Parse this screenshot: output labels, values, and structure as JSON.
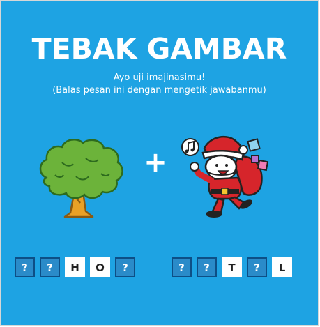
{
  "title": "TEBAK GAMBAR",
  "subtitle_line1": "Ayo uji imajinasimu!",
  "subtitle_line2": "(Balas pesan ini dengan mengetik jawabanmu)",
  "operator": "+",
  "clue_left_icon": "tree-icon",
  "clue_right_icon": "santa-claus-icon",
  "colors": {
    "background": "#1ea3e3",
    "hidden_tile": "#2a8bc9",
    "hidden_tile_border": "#0d4f86",
    "revealed_tile": "#ffffff"
  },
  "answer": {
    "word1": [
      {
        "char": "?",
        "revealed": false
      },
      {
        "char": "?",
        "revealed": false
      },
      {
        "char": "H",
        "revealed": true
      },
      {
        "char": "O",
        "revealed": true
      },
      {
        "char": "?",
        "revealed": false
      }
    ],
    "word2": [
      {
        "char": "?",
        "revealed": false
      },
      {
        "char": "?",
        "revealed": false
      },
      {
        "char": "T",
        "revealed": true
      },
      {
        "char": "?",
        "revealed": false
      },
      {
        "char": "L",
        "revealed": true
      }
    ]
  }
}
